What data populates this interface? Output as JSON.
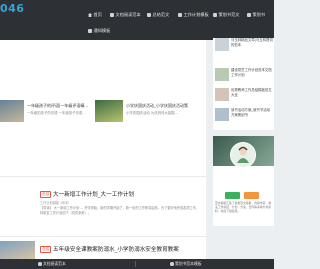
{
  "site": {
    "logo_text": "046"
  },
  "nav": {
    "items": [
      {
        "label": "首页",
        "icon": "home-icon"
      },
      {
        "label": "文档阅读范本",
        "icon": "cloud-icon"
      },
      {
        "label": "总结范文",
        "icon": "cloud-icon"
      },
      {
        "label": "工作计划模板",
        "icon": "cloud-icon"
      },
      {
        "label": "策划书范文",
        "icon": "cloud-icon"
      },
      {
        "label": "策划书",
        "icon": "cloud-icon"
      },
      {
        "label": "通知模板",
        "icon": "cloud-icon"
      }
    ]
  },
  "featured": [
    {
      "title": "一年级孩子的评语|一年级评语精...",
      "desc": "一年级的孩子的评语 一年级孩子评语..."
    },
    {
      "title": "小学庆国庆活动_小学庆国庆活动策",
      "desc": "小学庆国庆活动 为庆祝伟大祖国..."
    }
  ],
  "posts": [
    {
      "tag": "总结",
      "title": "大一新增工作计划_大一工作计划",
      "meta": "工作计划模板  2年前",
      "excerpt": "【导读】 大一新增工作计划 ... 开学伊始，新的学期开始了，新一轮的工作即将启航，为了更好地完成各项工作，特制定工作计划如下（仅供参考）。"
    },
    {
      "tag": "总结",
      "title": "五年级安全课教案防溺水_小学防溺水安全教育教案",
      "meta": "",
      "excerpt": ""
    }
  ],
  "sidebar": {
    "items": [
      {
        "text": "马玉林精品文章|马玉林提供的范本",
        "date": ""
      },
      {
        "text": "建设党员工作计划范本文档工作计划",
        "date": ""
      },
      {
        "text": "优秀教师工作总结模板范文大全",
        "date": ""
      },
      {
        "text": "读书活动方案_读书节活动方案策划书",
        "date": ""
      }
    ]
  },
  "profile": {
    "name": "",
    "text": "范文模板汇集了各类范文模板，内容丰富，涵盖工作总结、计划、方案、合同等多种文书资料，欢迎下载使用。"
  },
  "bottombar": {
    "left_label": "文档阅读范本",
    "right_label": "策划书范本模板"
  },
  "colors": {
    "nav_bg": "#2d3035",
    "logo": "#37a3d6",
    "accent": "#ef7e34",
    "tag": "#e05a4a"
  }
}
